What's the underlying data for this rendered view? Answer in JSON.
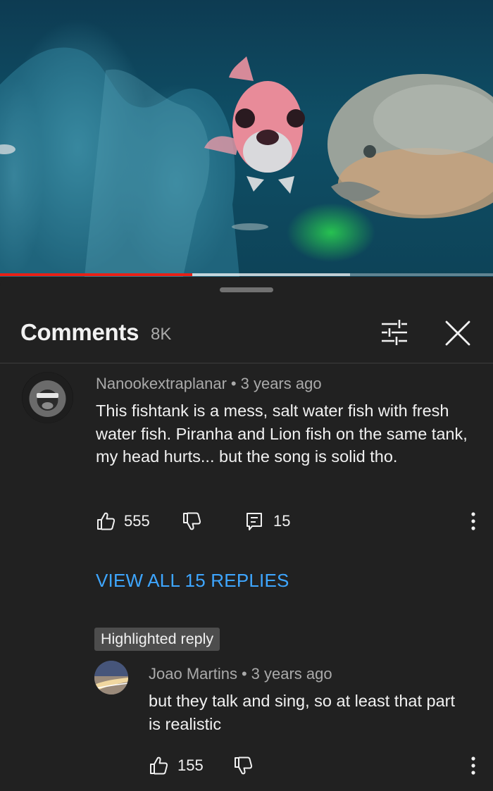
{
  "player": {
    "progress_played": 0.39,
    "progress_color": "#e62117"
  },
  "comments_panel": {
    "title": "Comments",
    "count": "8K",
    "filter_icon": "sliders-icon",
    "close_icon": "close-icon"
  },
  "top_comment": {
    "author": "Nanookextraplanar",
    "separator": "•",
    "time": "3 years ago",
    "text": "This fishtank is a mess, salt water fish with fresh water fish. Piranha and Lion fish on the same tank, my head hurts... but the song is solid tho.",
    "likes": "555",
    "replies": "15",
    "view_replies_label": "VIEW ALL 15 REPLIES"
  },
  "highlighted_reply": {
    "badge": "Highlighted reply",
    "author": "Joao Martins",
    "separator": "•",
    "time": "3 years ago",
    "text": "but they talk and sing, so at least that part is realistic",
    "likes": "155"
  },
  "colors": {
    "background": "#212121",
    "link": "#3ea6ff",
    "secondary_text": "#aaaaaa"
  }
}
